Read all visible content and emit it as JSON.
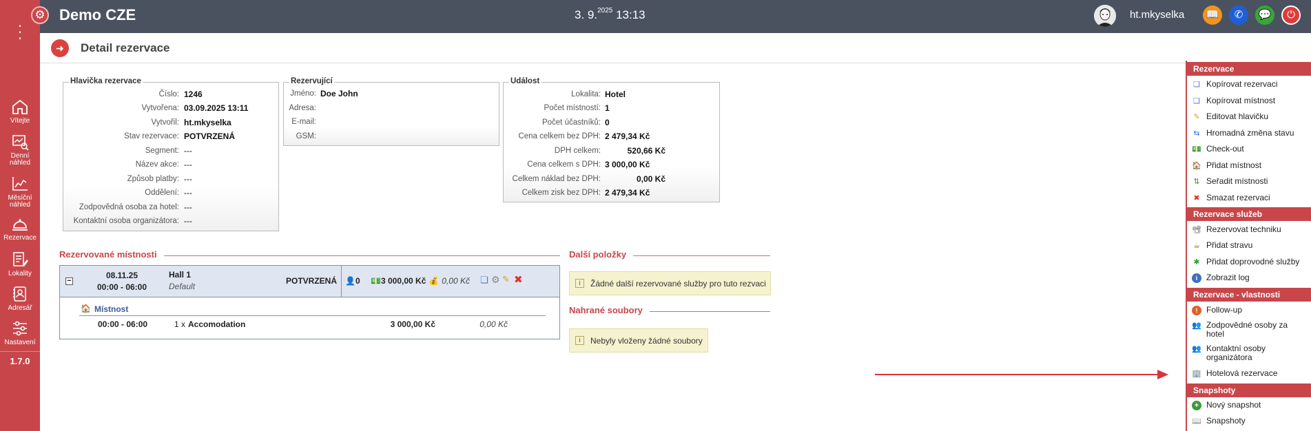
{
  "rail": {
    "items": [
      {
        "label": "Vítejte"
      },
      {
        "label": "Denní náhled"
      },
      {
        "label": "Měsíční náhled"
      },
      {
        "label": "Rezervace"
      },
      {
        "label": "Lokality"
      },
      {
        "label": "Adresář"
      },
      {
        "label": "Nastavení"
      }
    ],
    "version": "1.7.0"
  },
  "topbar": {
    "title": "Demo CZE",
    "date_day": "3. 9.",
    "date_year": "2025",
    "time": "13:13",
    "username": "ht.mkyselka",
    "colors": {
      "bar": "#4a5260",
      "rail": "#c8464a"
    }
  },
  "page": {
    "title": "Detail rezervace"
  },
  "header_box": {
    "legend": "Hlavička rezervace",
    "rows": [
      {
        "label": "Číslo:",
        "value": "1246"
      },
      {
        "label": "Vytvořena:",
        "value": "03.09.2025 13:11"
      },
      {
        "label": "Vytvořil:",
        "value": "ht.mkyselka"
      },
      {
        "label": "Stav rezervace:",
        "value": "POTVRZENÁ"
      },
      {
        "label": "Segment:",
        "value": "---"
      },
      {
        "label": "Název akce:",
        "value": "---"
      },
      {
        "label": "Způsob platby:",
        "value": "---"
      },
      {
        "label": "Oddělení:",
        "value": "---"
      },
      {
        "label": "Zodpovědná osoba za hotel:",
        "value": "---"
      },
      {
        "label": "Kontaktní osoba organizátora:",
        "value": "---"
      }
    ]
  },
  "booker_box": {
    "legend": "Rezervující",
    "rows": [
      {
        "label": "Jméno:",
        "value": "Doe John"
      },
      {
        "label": "Adresa:",
        "value": ""
      },
      {
        "label": "E-mail:",
        "value": ""
      },
      {
        "label": "GSM:",
        "value": ""
      }
    ]
  },
  "event_box": {
    "legend": "Událost",
    "rows": [
      {
        "label": "Lokalita:",
        "value": "Hotel"
      },
      {
        "label": "Počet místností:",
        "value": "1"
      },
      {
        "label": "Počet účastníků:",
        "value": "0"
      },
      {
        "label": "Cena celkem bez DPH:",
        "value": "2 479,34 Kč"
      },
      {
        "label": "DPH celkem:",
        "value": "520,66 Kč"
      },
      {
        "label": "Cena celkem s DPH:",
        "value": "3 000,00 Kč"
      },
      {
        "label": "Celkem náklad bez DPH:",
        "value": "0,00 Kč"
      },
      {
        "label": "Celkem zisk bez DPH:",
        "value": "2 479,34 Kč"
      }
    ]
  },
  "rooms": {
    "title": "Rezervované místnosti",
    "room": {
      "date": "08.11.25",
      "time": "00:00 - 06:00",
      "name": "Hall 1",
      "layout": "Default",
      "status": "POTVRZENÁ",
      "persons": "0",
      "price": "3 000,00 Kč",
      "cost": "0,00 Kč",
      "collapse": "−"
    },
    "sub_title": "Místnost",
    "sub_row": {
      "time": "00:00 - 06:00",
      "qty": "1 x",
      "item": "Accomodation",
      "price": "3 000,00 Kč",
      "cost": "0,00 Kč"
    }
  },
  "other": {
    "title": "Další položky",
    "notice": "Žádné další rezervované služby pro tuto rezvaci"
  },
  "files": {
    "title": "Nahrané soubory",
    "notice": "Nebyly vloženy žádné soubory"
  },
  "right_panel": {
    "sections": [
      {
        "title": "Rezervace",
        "items": [
          "Kopírovat rezervaci",
          "Kopírovat místnost",
          "Editovat hlavičku",
          "Hromadná změna stavu",
          "Check-out",
          "Přidat místnost",
          "Seřadit místnosti",
          "Smazat rezervaci"
        ]
      },
      {
        "title": "Rezervace služeb",
        "items": [
          "Rezervovat techniku",
          "Přidat stravu",
          "Přidat doprovodné služby",
          "Zobrazit log"
        ]
      },
      {
        "title": "Rezervace - vlastnosti",
        "items": [
          "Follow-up",
          "Zodpovědné osoby za hotel",
          "Kontaktní osoby organizátora",
          "Hotelová rezervace"
        ]
      },
      {
        "title": "Snapshoty",
        "items": [
          "Nový snapshot",
          "Snapshoty"
        ]
      }
    ]
  }
}
